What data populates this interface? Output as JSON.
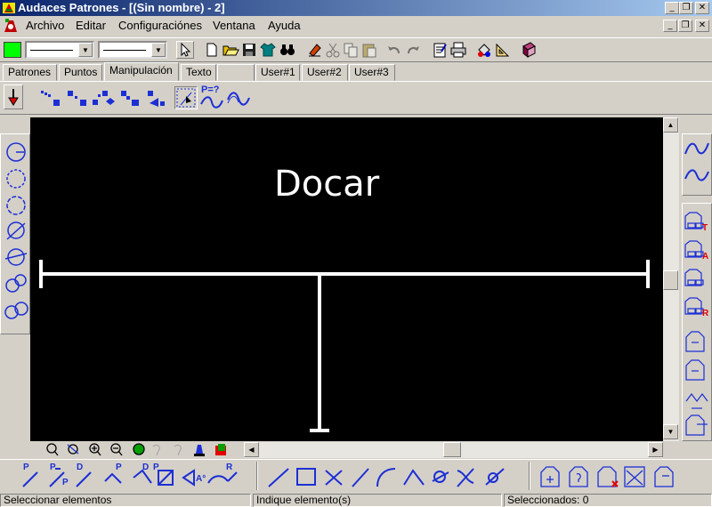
{
  "window": {
    "title": "Audaces Patrones - [(Sin nombre) - 2]",
    "caption_buttons": [
      "_",
      "❐",
      "✕"
    ]
  },
  "menu": {
    "items": [
      "Archivo",
      "Editar",
      "Configuraciónes",
      "Ventana",
      "Ayuda"
    ],
    "mdi_buttons": [
      "_",
      "❐",
      "✕"
    ]
  },
  "toolbar": {
    "color_swatch": "#00ff00",
    "line_style_1": "solid",
    "line_style_2": "solid"
  },
  "tabs": {
    "items": [
      "Patrones",
      "Puntos",
      "Manipulación",
      "Texto",
      "",
      "User#1",
      "User#2",
      "User#3"
    ],
    "active": "Manipulación"
  },
  "manip": {
    "formula_label": "P=?"
  },
  "canvas": {
    "background": "#000000",
    "drawing_color": "#ffffff",
    "text": "Docar"
  },
  "bottom_tools": {
    "point_labels": [
      "P",
      "P",
      "P",
      "P",
      "D",
      "P",
      "D",
      "A°",
      "R"
    ]
  },
  "side_tools": {
    "letters": [
      "T",
      "A",
      "",
      "R"
    ]
  },
  "status": {
    "left": "Seleccionar elementos",
    "middle": "Indique elemento(s)",
    "right": "Seleccionados: 0"
  },
  "colors": {
    "title_gradient_start": "#0a246a",
    "title_gradient_end": "#a6caf0",
    "face": "#d4d0c8",
    "icon_blue": "#1c2fd4",
    "letter_red": "#e00000"
  }
}
